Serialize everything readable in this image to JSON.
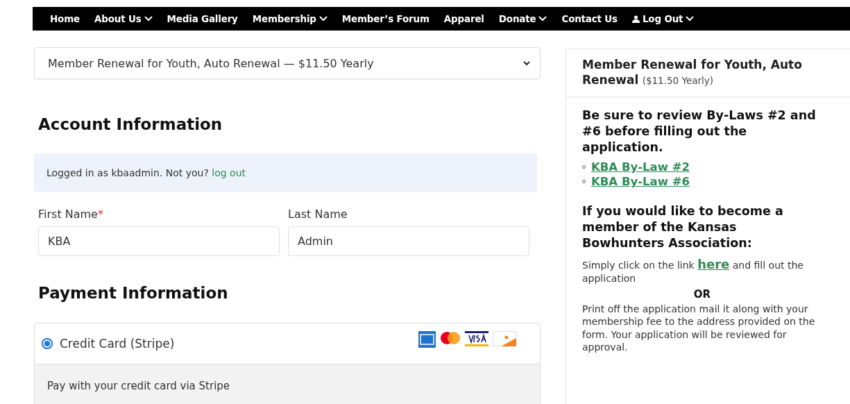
{
  "nav": [
    {
      "label": "Home",
      "kind": "link"
    },
    {
      "label": "About Us",
      "kind": "menu"
    },
    {
      "label": "Media Gallery",
      "kind": "link"
    },
    {
      "label": "Membership",
      "kind": "menu"
    },
    {
      "label": "Member’s Forum",
      "kind": "link"
    },
    {
      "label": "Apparel",
      "kind": "link"
    },
    {
      "label": "Donate",
      "kind": "menu"
    },
    {
      "label": "Contact Us",
      "kind": "link"
    },
    {
      "label": "Log Out",
      "kind": "account"
    }
  ],
  "level_select": {
    "value": "Member Renewal for Youth, Auto Renewal — $11.50 Yearly"
  },
  "account": {
    "heading": "Account Information",
    "notice": "Logged in as kbaadmin. Not you?",
    "notice_link": "log out",
    "fields": [
      {
        "label": "First Name",
        "marker": "*",
        "value": "KBA"
      },
      {
        "label": "Last Name",
        "value": "Admin"
      }
    ]
  },
  "payment": {
    "heading": "Payment Information",
    "methods": [
      {
        "label": "Credit Card (Stripe)",
        "selected": true,
        "description": "Pay with your credit card via Stripe"
      }
    ]
  },
  "sidebar": {
    "title": "Member Renewal for Youth, Auto Renewal",
    "price": "($11.50 Yearly)",
    "review_heading": "Be sure to review By-Laws #2 and #6 before filling out the application.",
    "bylaw_links": [
      "KBA By-Law #2",
      "KBA By-Law #6"
    ],
    "join_heading": "If you would like to become a member of the Kansas Bowhunters Association:",
    "join_before": "Simply click on the link",
    "join_link": "here",
    "join_after": "and fill out the application",
    "or": "OR",
    "mail_text": "Print off the application mail it along with your membership fee to the address provided on the form. Your application will be reviewed for approval."
  }
}
